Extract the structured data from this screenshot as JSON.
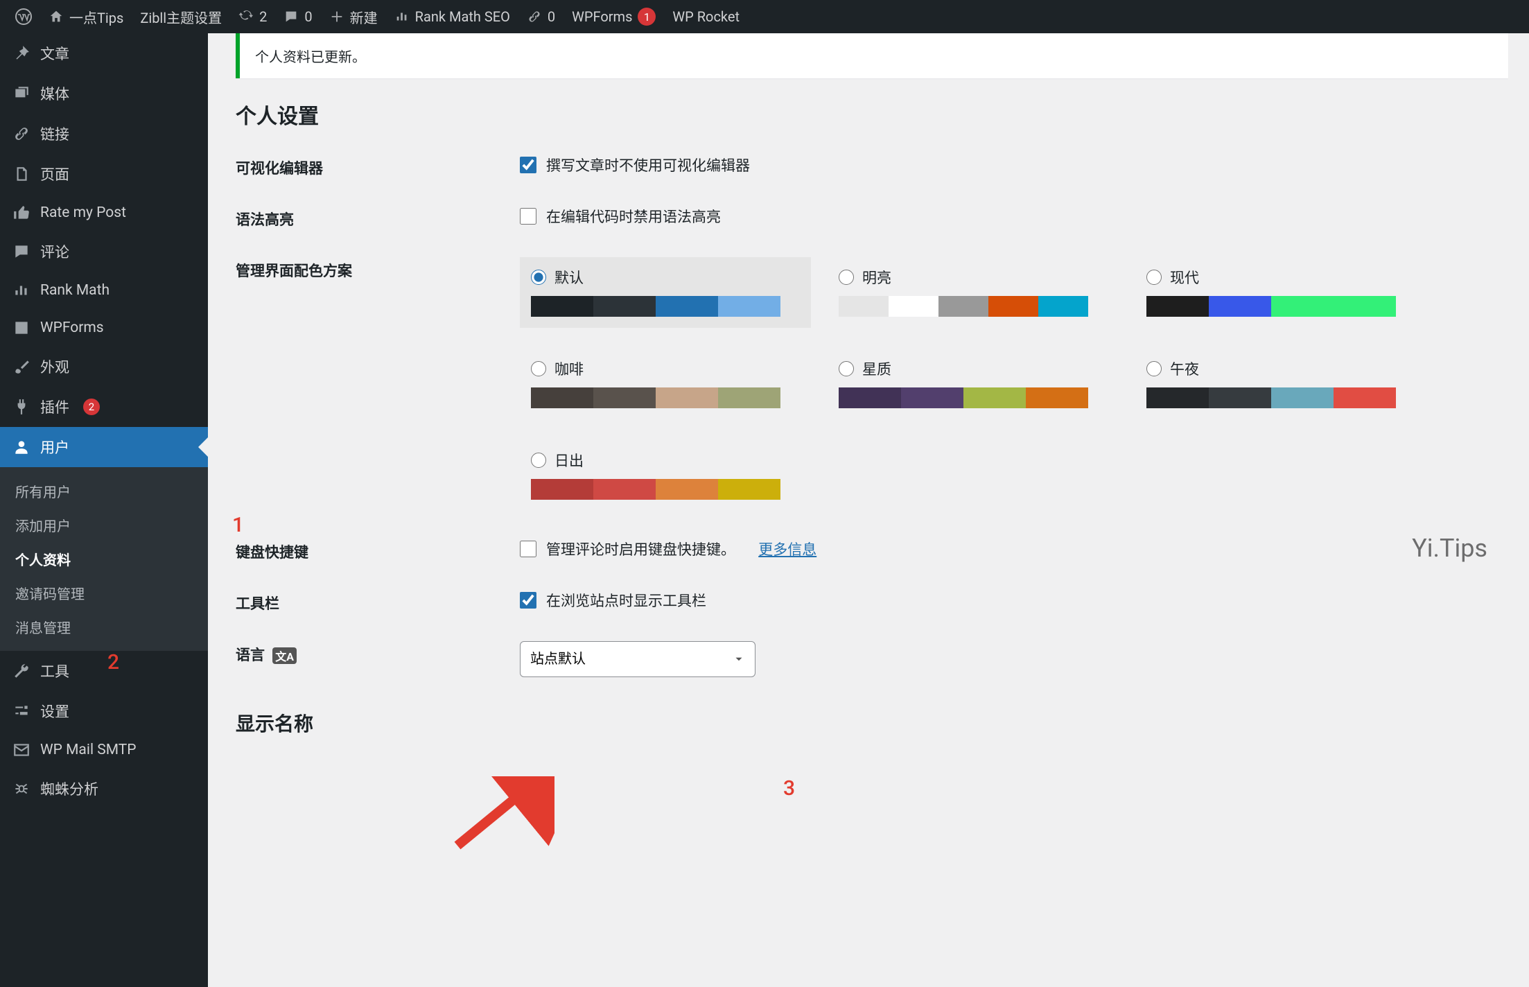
{
  "adminbar": {
    "site_name": "一点Tips",
    "theme_settings": "Zibll主题设置",
    "updates_count": "2",
    "comments_count": "0",
    "new_label": "新建",
    "rankmath": "Rank Math SEO",
    "links_count": "0",
    "wpforms_label": "WPForms",
    "wpforms_badge": "1",
    "wprocket": "WP Rocket"
  },
  "sidebar": {
    "items": [
      {
        "label": "文章"
      },
      {
        "label": "媒体"
      },
      {
        "label": "链接"
      },
      {
        "label": "页面"
      },
      {
        "label": "Rate my Post"
      },
      {
        "label": "评论"
      },
      {
        "label": "Rank Math"
      },
      {
        "label": "WPForms"
      },
      {
        "label": "外观"
      },
      {
        "label": "插件",
        "badge": "2"
      },
      {
        "label": "用户"
      },
      {
        "label": "工具"
      },
      {
        "label": "设置"
      },
      {
        "label": "WP Mail SMTP"
      },
      {
        "label": "蜘蛛分析"
      }
    ],
    "submenu": [
      "所有用户",
      "添加用户",
      "个人资料",
      "邀请码管理",
      "消息管理"
    ]
  },
  "notice": "个人资料已更新。",
  "page_title": "个人设置",
  "rows": {
    "visual_editor": {
      "label": "可视化编辑器",
      "checkbox": "撰写文章时不使用可视化编辑器",
      "checked": true
    },
    "syntax_highlight": {
      "label": "语法高亮",
      "checkbox": "在编辑代码时禁用语法高亮",
      "checked": false
    },
    "color_scheme_label": "管理界面配色方案",
    "keyboard": {
      "label": "键盘快捷键",
      "checkbox": "管理评论时启用键盘快捷键。",
      "more": "更多信息"
    },
    "toolbar": {
      "label": "工具栏",
      "checkbox": "在浏览站点时显示工具栏",
      "checked": true
    },
    "language": {
      "label": "语言",
      "icon_label": "🅰",
      "value": "站点默认"
    },
    "display_name_title": "显示名称"
  },
  "schemes": [
    {
      "name": "默认",
      "selected": true,
      "colors": [
        "#1d2327",
        "#2c3338",
        "#2271b1",
        "#72aee6"
      ]
    },
    {
      "name": "明亮",
      "selected": false,
      "colors": [
        "#e5e5e5",
        "#ffffff",
        "#999999",
        "#d64e07",
        "#04a4cc"
      ]
    },
    {
      "name": "现代",
      "selected": false,
      "colors": [
        "#1e1e1e",
        "#3858e9",
        "#33f078",
        "#33f078"
      ]
    },
    {
      "name": "咖啡",
      "selected": false,
      "colors": [
        "#46403c",
        "#59524c",
        "#c7a589",
        "#9ea476"
      ]
    },
    {
      "name": "星质",
      "selected": false,
      "colors": [
        "#413256",
        "#523f6d",
        "#a3b745",
        "#d46f15"
      ]
    },
    {
      "name": "午夜",
      "selected": false,
      "colors": [
        "#25282b",
        "#363b3f",
        "#69a8bb",
        "#e14d43"
      ]
    },
    {
      "name": "日出",
      "selected": false,
      "colors": [
        "#b43c38",
        "#cf4944",
        "#dd823b",
        "#ccaf0b"
      ]
    }
  ],
  "annotations": {
    "a1": "1",
    "a2": "2",
    "a3": "3",
    "watermark": "Yi.Tips"
  }
}
